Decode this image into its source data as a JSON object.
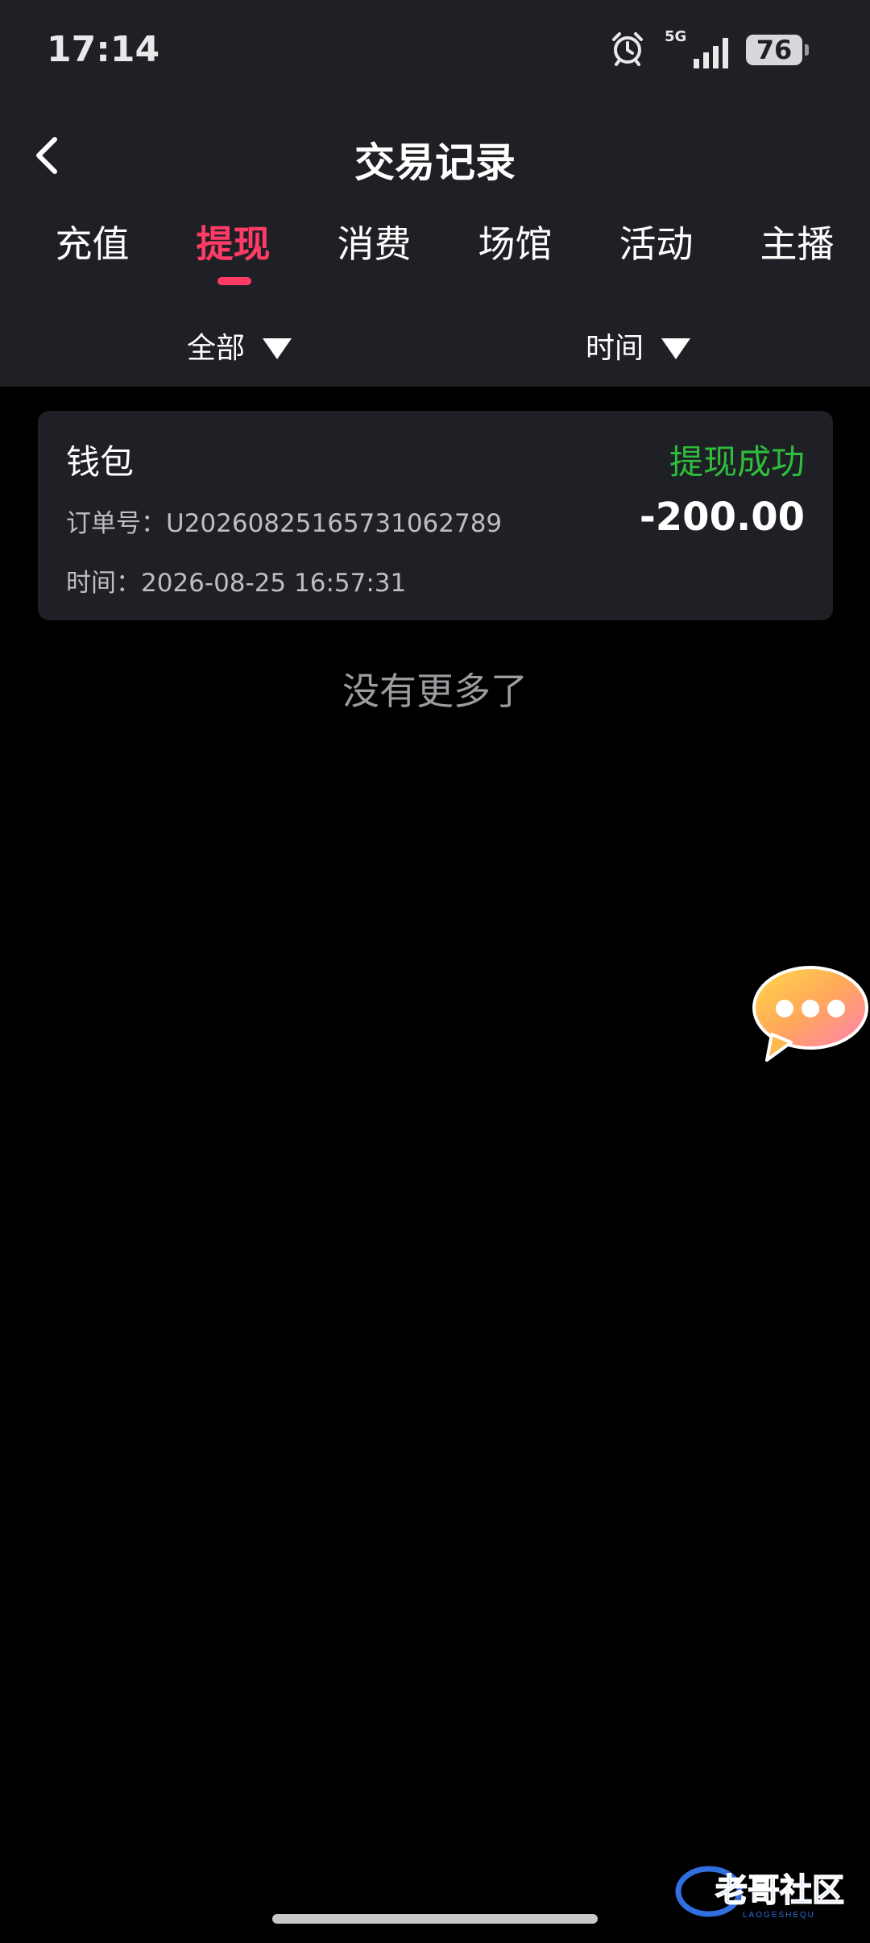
{
  "status_bar": {
    "time": "17:14",
    "network": "5G",
    "battery": "76",
    "icons": [
      "alarm-icon",
      "signal-icon",
      "battery-icon"
    ]
  },
  "header": {
    "title": "交易记录",
    "back_icon": "chevron-left-icon"
  },
  "tabs": [
    {
      "label": "充值",
      "active": false
    },
    {
      "label": "提现",
      "active": true
    },
    {
      "label": "消费",
      "active": false
    },
    {
      "label": "场馆",
      "active": false
    },
    {
      "label": "活动",
      "active": false
    },
    {
      "label": "主播",
      "active": false
    }
  ],
  "filters": {
    "type": {
      "label": "全部",
      "icon": "triangle-down-icon"
    },
    "time": {
      "label": "时间",
      "icon": "triangle-down-icon"
    }
  },
  "records": [
    {
      "title": "钱包",
      "status": "提现成功",
      "order": "订单号：U20260825165731062789",
      "amount": "-200.00",
      "time": "时间：2026-08-25 16:57:31"
    }
  ],
  "footer_text": "没有更多了",
  "floating_button_icon": "chat-bubble-icon",
  "watermark": {
    "text": "老哥社区",
    "subtext": "LAOGESHEQU"
  },
  "colors": {
    "accent": "#ff3b66",
    "success": "#2ebd3c",
    "panel": "#1f2025",
    "background": "#000000"
  }
}
